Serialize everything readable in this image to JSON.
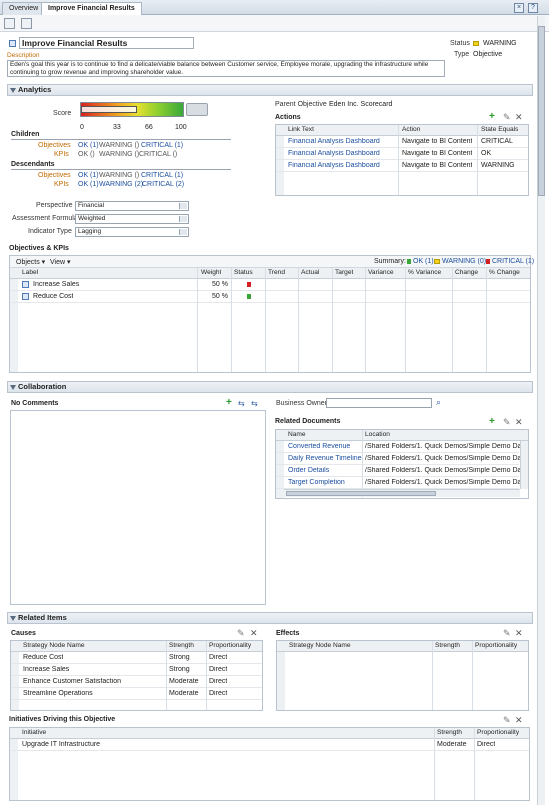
{
  "tabs": {
    "overview": "Overview",
    "active": "Improve Financial Results"
  },
  "header": {
    "title": "Improve Financial Results",
    "description_label": "Description",
    "description": "Eden's goal this year is to continue to find a delicate/viable balance between Customer service, Employee morale, upgrading the infrastructure while continuing to grow revenue and improving shareholder value.",
    "status_label": "Status",
    "status_value": "WARNING",
    "type_label": "Type",
    "type_value": "Objective"
  },
  "analytics": {
    "title": "Analytics",
    "score_label": "Score",
    "ticks": [
      "0",
      "33",
      "66",
      "100"
    ],
    "score_fraction": 0.55,
    "children_title": "Children",
    "desc_title": "Descendants",
    "objectives_label": "Objectives",
    "kpis_label": "KPIs",
    "child_obj": {
      "ok": "OK (1)",
      "warn": "WARNING ()",
      "crit": "CRITICAL (1)"
    },
    "child_kpi": {
      "ok": "OK ()",
      "warn": "WARNING ()",
      "crit": "CRITICAL ()"
    },
    "desc_obj": {
      "ok": "OK (1)",
      "warn": "WARNING ()",
      "crit": "CRITICAL (1)"
    },
    "desc_kpi": {
      "ok": "OK (1)",
      "warn": "WARNING (2)",
      "crit": "CRITICAL (2)"
    },
    "perspective_label": "Perspective",
    "perspective": "Financial",
    "formula_label": "Assessment Formula",
    "formula": "Weighted",
    "indicator_label": "Indicator Type",
    "indicator": "Lagging",
    "parent_label": "Parent Objective",
    "parent_value": "Eden Inc. Scorecard",
    "actions_title": "Actions",
    "actions_cols": [
      "Link Text",
      "Action",
      "State Equals"
    ],
    "actions_rows": [
      [
        "Financial Analysis Dashboard",
        "Navigate to BI Content",
        "CRITICAL"
      ],
      [
        "Financial Analysis Dashboard",
        "Navigate to BI Content",
        "OK"
      ],
      [
        "Financial Analysis Dashboard",
        "Navigate to BI Content",
        "WARNING"
      ]
    ]
  },
  "objkpi": {
    "title": "Objectives & KPIs",
    "objects_menu": "Objects ▾",
    "view_menu": "View ▾",
    "summary_label": "Summary:",
    "sum_ok": "OK (1)",
    "sum_warn": "WARNING (0)",
    "sum_crit": "CRITICAL (1)",
    "cols": [
      "Label",
      "Weight",
      "Status",
      "Trend",
      "Actual",
      "Target",
      "Variance",
      "% Variance",
      "Change",
      "% Change"
    ],
    "rows": [
      {
        "label": "Increase Sales",
        "weight": "50 %",
        "status": "red"
      },
      {
        "label": "Reduce Cost",
        "weight": "50 %",
        "status": "green"
      }
    ]
  },
  "collab": {
    "title": "Collaboration",
    "no_comments": "No Comments",
    "business_owner_label": "Business Owner",
    "related_docs_title": "Related Documents",
    "docs_cols": [
      "Name",
      "Location"
    ],
    "docs": [
      [
        "Converted Revenue",
        "/Shared Folders/1. Quick Demos/Simple Demo Dashboard"
      ],
      [
        "Daily Revenue Timeline",
        "/Shared Folders/1. Quick Demos/Simple Demo Dashboard"
      ],
      [
        "Order Details",
        "/Shared Folders/1. Quick Demos/Simple Demo Dashboard"
      ],
      [
        "Target Completion",
        "/Shared Folders/1. Quick Demos/Simple Demo Dashboard"
      ]
    ]
  },
  "related": {
    "title": "Related Items",
    "causes_title": "Causes",
    "effects_title": "Effects",
    "cols": [
      "Strategy Node Name",
      "Strength",
      "Proportionality"
    ],
    "causes": [
      [
        "Reduce Cost",
        "Strong",
        "Direct"
      ],
      [
        "Increase Sales",
        "Strong",
        "Direct"
      ],
      [
        "Enhance Customer Satisfaction",
        "Moderate",
        "Direct"
      ],
      [
        "Streamline Operations",
        "Moderate",
        "Direct"
      ]
    ],
    "initiatives_title": "Initiatives Driving this Objective",
    "init_cols": [
      "Initiative",
      "Strength",
      "Proportionality"
    ],
    "initiatives": [
      [
        "Upgrade IT Infrastructure",
        "Moderate",
        "Direct"
      ]
    ]
  }
}
